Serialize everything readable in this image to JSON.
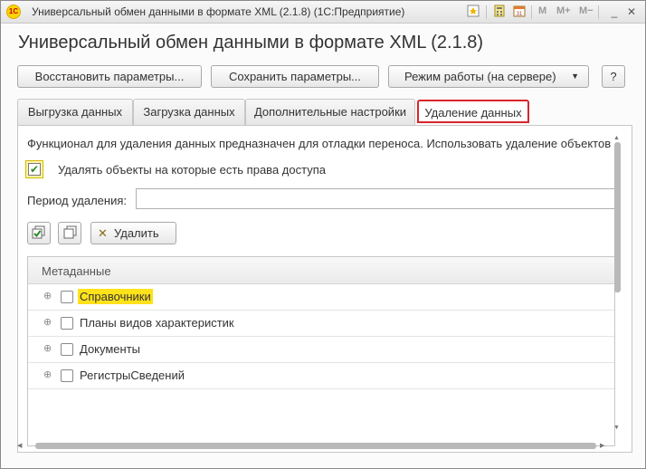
{
  "window": {
    "title": "Универсальный обмен данными в формате XML (2.1.8)  (1С:Предприятие)",
    "app_icon_text": "1С",
    "toolbar": {
      "m": "M",
      "m_plus": "M+",
      "m_minus": "M−",
      "minimize": "_",
      "maximize": "□",
      "close": "✕"
    }
  },
  "page": {
    "title": "Универсальный обмен данными в формате XML (2.1.8)"
  },
  "commands": {
    "restore": "Восстановить параметры...",
    "save": "Сохранить параметры...",
    "mode": "Режим работы (на сервере)",
    "mode_arrow": "▼",
    "help": "?"
  },
  "tabs": [
    {
      "label": "Выгрузка данных",
      "active": false
    },
    {
      "label": "Загрузка данных",
      "active": false
    },
    {
      "label": "Дополнительные настройки",
      "active": false
    },
    {
      "label": "Удаление данных",
      "active": true
    }
  ],
  "delete_tab": {
    "description": "Функционал для удаления данных предназначен для отладки переноса. Использовать удаление объектов",
    "checkbox_label": "Удалять объекты на которые есть права доступа",
    "checkbox_checked": true,
    "period_label": "Период удаления:",
    "period_value": "",
    "delete_button": "Удалить"
  },
  "tree": {
    "header": "Метаданные",
    "rows": [
      {
        "label": "Справочники",
        "checked": false,
        "highlighted": true
      },
      {
        "label": "Планы видов характеристик",
        "checked": false,
        "highlighted": false
      },
      {
        "label": "Документы",
        "checked": false,
        "highlighted": false
      },
      {
        "label": "РегистрыСведений",
        "checked": false,
        "highlighted": false
      }
    ]
  },
  "colors": {
    "active_tab_border": "#d7262b",
    "highlight": "#ffe21a",
    "checkbox_focus": "#fff5a8",
    "check_mark": "#2a8a2a"
  }
}
